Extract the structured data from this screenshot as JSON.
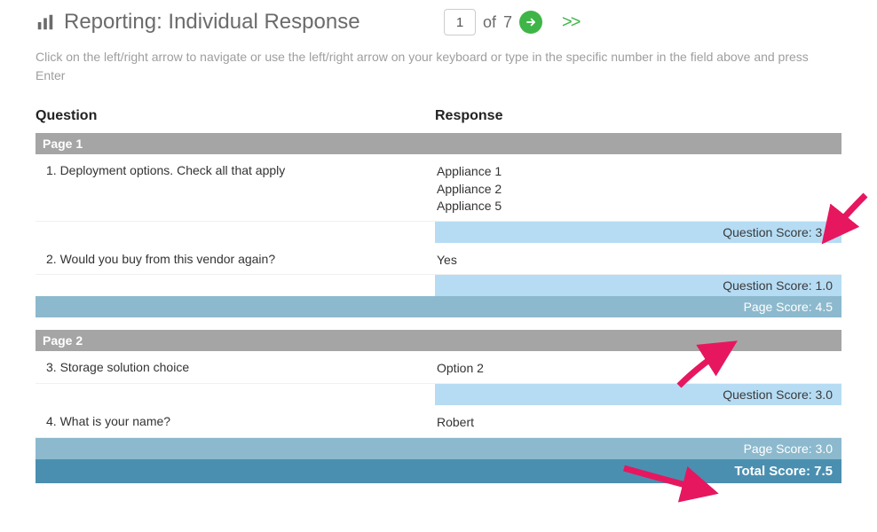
{
  "title": "Reporting: Individual Response",
  "nav": {
    "current": "1",
    "of_label": "of",
    "total": "7",
    "forward_label": ">>"
  },
  "instructions": "Click on the left/right arrow to navigate or use the left/right arrow on your keyboard or type in the specific number in the field above and press Enter",
  "headings": {
    "question": "Question",
    "response": "Response"
  },
  "pages": [
    {
      "label": "Page 1",
      "questions": [
        {
          "q": "1. Deployment options.  Check all that apply",
          "r": [
            "Appliance 1",
            "Appliance 2",
            "Appliance 5"
          ],
          "score_label": "Question Score: 3.5"
        },
        {
          "q": "2. Would you buy from this vendor again?",
          "r": [
            "Yes"
          ],
          "score_label": "Question Score: 1.0"
        }
      ],
      "page_score_label": "Page Score: 4.5"
    },
    {
      "label": "Page 2",
      "questions": [
        {
          "q": "3. Storage solution choice",
          "r": [
            "Option 2"
          ],
          "score_label": "Question Score: 3.0"
        },
        {
          "q": "4. What is your name?",
          "r": [
            "Robert"
          ],
          "score_label": ""
        }
      ],
      "page_score_label": "Page Score: 3.0"
    }
  ],
  "total_score_label": "Total Score: 7.5"
}
